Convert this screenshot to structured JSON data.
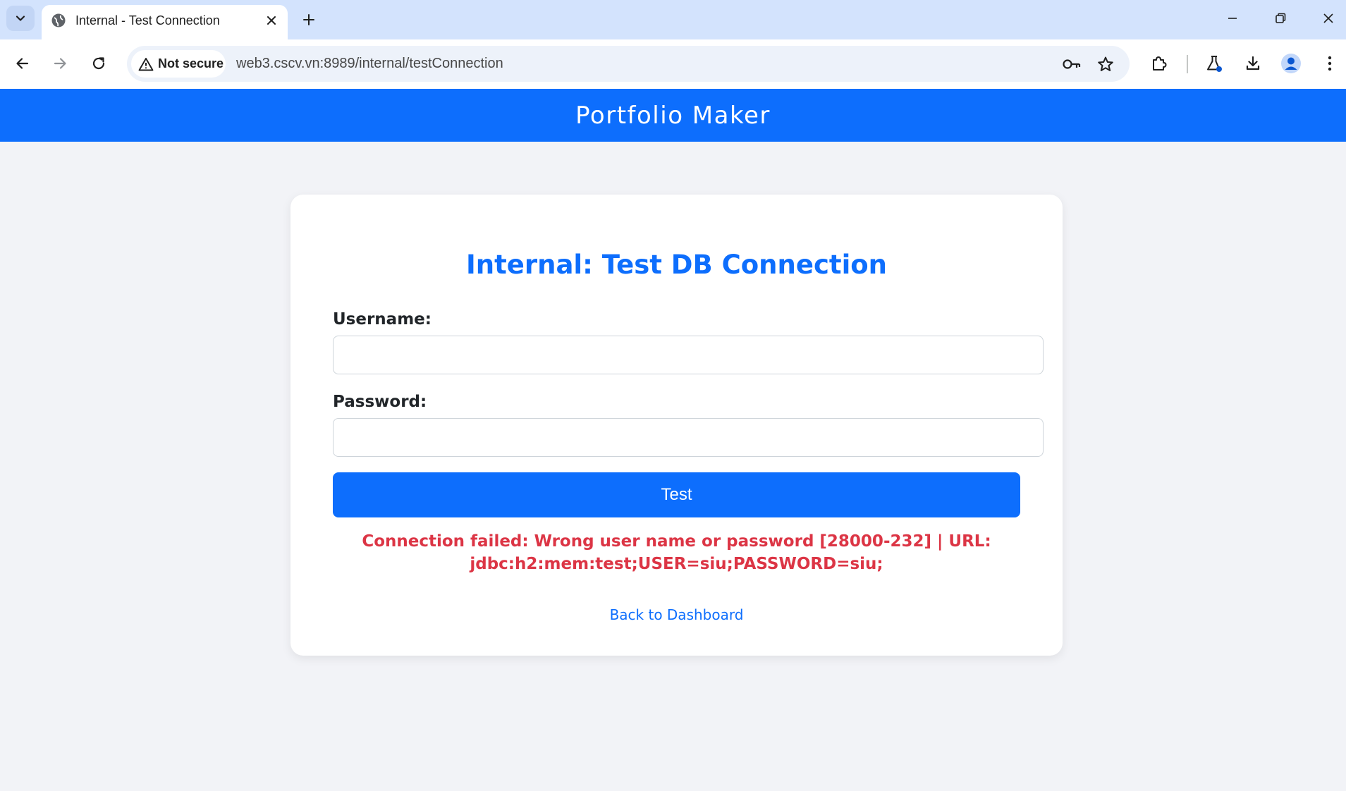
{
  "browser": {
    "tab": {
      "title": "Internal - Test Connection"
    },
    "security_label": "Not secure",
    "url": "web3.cscv.vn:8989/internal/testConnection",
    "accent": "#d3e3fd"
  },
  "header": {
    "title": "Portfolio Maker",
    "background": "#0d6efd"
  },
  "form": {
    "title": "Internal: Test DB Connection",
    "username_label": "Username:",
    "username_value": "",
    "password_label": "Password:",
    "password_value": "",
    "submit_label": "Test"
  },
  "result": {
    "error_line1": "Connection failed: Wrong user name or password [28000-232] | URL:",
    "error_line2": "jdbc:h2:mem:test;USER=siu;PASSWORD=siu;",
    "color": "#dc3545"
  },
  "nav": {
    "back_label": "Back to Dashboard"
  }
}
